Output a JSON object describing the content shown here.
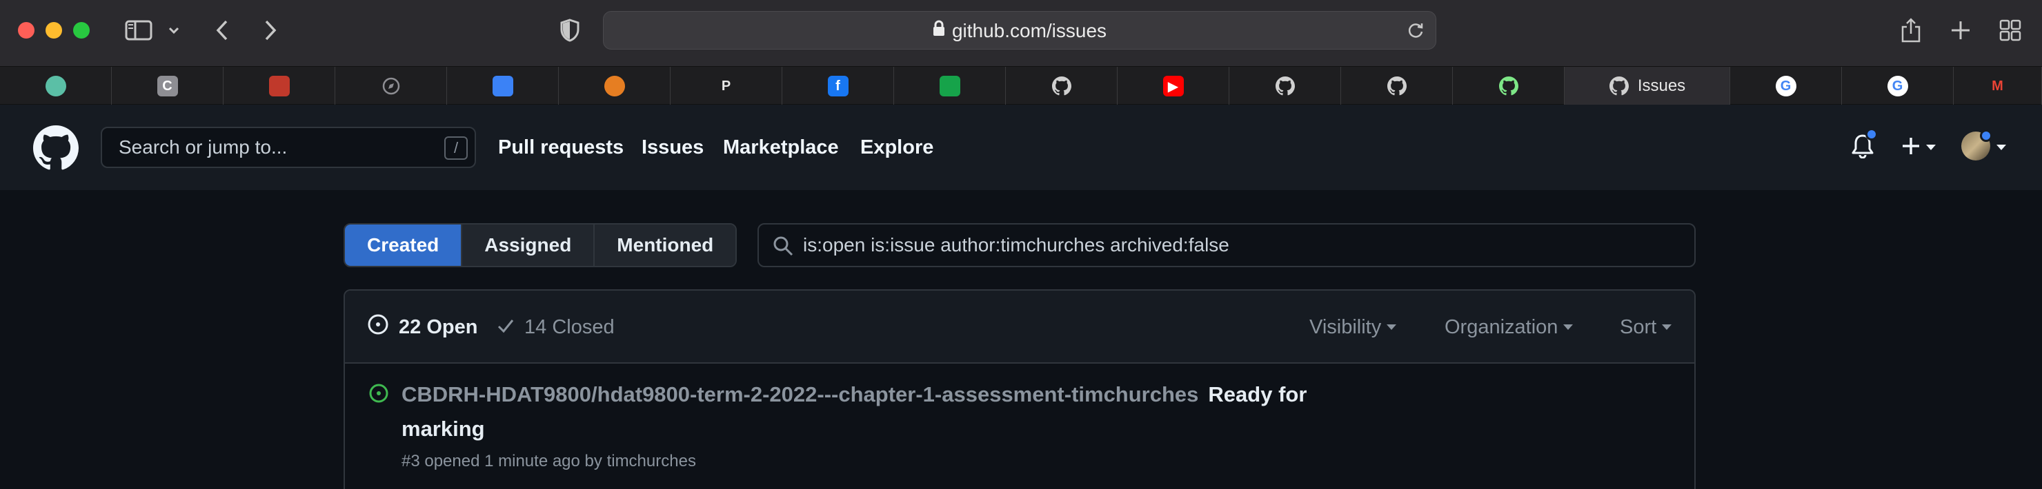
{
  "browser": {
    "url": "github.com/issues",
    "tabs": [
      {
        "favicon": "chatgpt-icon",
        "color": "#5bbfa6",
        "glyph": ""
      },
      {
        "favicon": "c-icon",
        "color": "#8e8e93",
        "glyph": "C"
      },
      {
        "favicon": "stripes-icon",
        "color": "#c0392b",
        "glyph": ""
      },
      {
        "favicon": "compass-icon",
        "color": "#8e8e93",
        "glyph": ""
      },
      {
        "favicon": "shield-icon",
        "color": "#3b82f6",
        "glyph": ""
      },
      {
        "favicon": "colorwheel-icon",
        "color": "#e67e22",
        "glyph": ""
      },
      {
        "favicon": "p-icon",
        "color": "#1e3a8a",
        "glyph": "P"
      },
      {
        "favicon": "facebook-icon",
        "color": "#1877f2",
        "glyph": "f"
      },
      {
        "favicon": "grid-icon",
        "color": "#16a34a",
        "glyph": ""
      },
      {
        "favicon": "github-icon",
        "color": "#d0d0d0",
        "glyph": ""
      },
      {
        "favicon": "youtube-icon",
        "color": "#ff0000",
        "glyph": "▶"
      },
      {
        "favicon": "github-icon",
        "color": "#d0d0d0",
        "glyph": ""
      },
      {
        "favicon": "github-icon",
        "color": "#d0d0d0",
        "glyph": ""
      },
      {
        "favicon": "github-icon",
        "color": "#7ee787",
        "glyph": ""
      },
      {
        "favicon": "github-icon",
        "color": "#d0d0d0",
        "glyph": "",
        "label": "Issues",
        "active": true
      },
      {
        "favicon": "google-icon",
        "color": "#ffffff",
        "glyph": "G"
      },
      {
        "favicon": "google-icon",
        "color": "#ffffff",
        "glyph": "G"
      },
      {
        "favicon": "gmail-icon",
        "color": "#ea4335",
        "glyph": "M"
      }
    ]
  },
  "header": {
    "search_placeholder": "Search or jump to...",
    "search_shortcut": "/",
    "nav": [
      "Pull requests",
      "Issues",
      "Marketplace",
      "Explore"
    ]
  },
  "main": {
    "segments": [
      "Created",
      "Assigned",
      "Mentioned"
    ],
    "active_segment": "Created",
    "filter_query": "is:open is:issue author:timchurches archived:false",
    "open_count_label": "22 Open",
    "closed_count_label": "14 Closed",
    "dropdowns": [
      "Visibility",
      "Organization",
      "Sort"
    ],
    "issues": [
      {
        "repo": "CBDRH-HDAT9800/hdat9800-term-2-2022---chapter-1-assessment-timchurches",
        "title": "Ready for marking",
        "meta": "#3 opened 1 minute ago by timchurches"
      }
    ]
  },
  "colors": {
    "accent": "#316dca",
    "open_green": "#3fb950",
    "notification_dot": "#3b82f6"
  }
}
